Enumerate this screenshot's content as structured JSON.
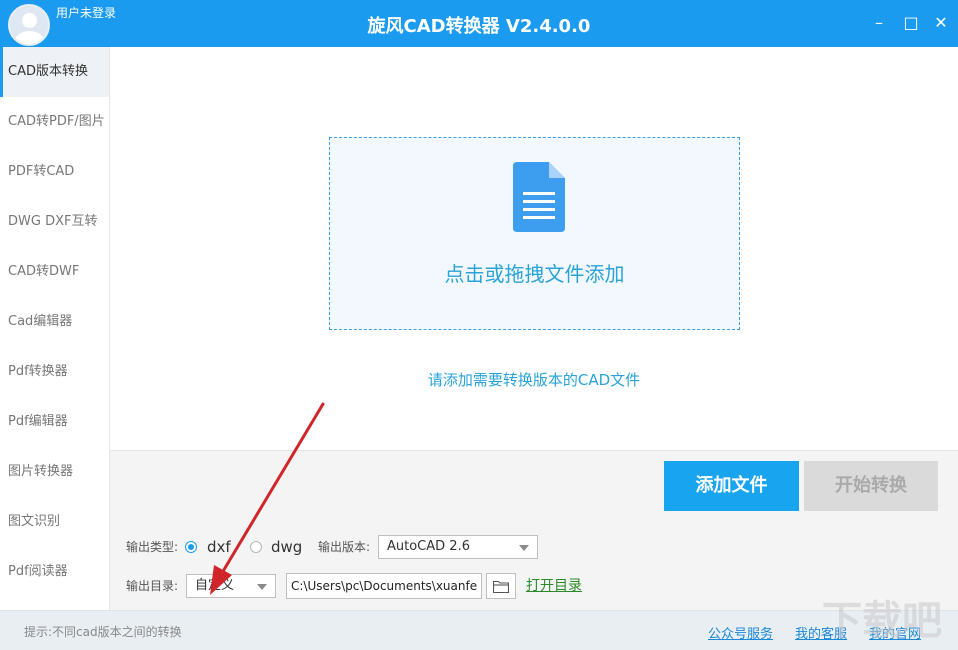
{
  "window": {
    "title": "旋风CAD转换器 V2.4.0.0",
    "user_label": "用户未登录",
    "controls": {
      "minimize": "–",
      "maximize": "□",
      "close": "✕"
    }
  },
  "sidebar": {
    "items": [
      {
        "label": "CAD版本转换",
        "active": true
      },
      {
        "label": "CAD转PDF/图片"
      },
      {
        "label": "PDF转CAD"
      },
      {
        "label": "DWG DXF互转"
      },
      {
        "label": "CAD转DWF"
      },
      {
        "label": "Cad编辑器"
      },
      {
        "label": "Pdf转换器"
      },
      {
        "label": "Pdf编辑器"
      },
      {
        "label": "图片转换器"
      },
      {
        "label": "图文识别"
      },
      {
        "label": "Pdf阅读器"
      }
    ]
  },
  "dropzone": {
    "text": "点击或拖拽文件添加",
    "icon": "document-icon"
  },
  "hint": "请添加需要转换版本的CAD文件",
  "actions": {
    "add_files": "添加文件",
    "start_convert": "开始转换"
  },
  "options": {
    "output_type_label": "输出类型:",
    "output_types": [
      {
        "label": "dxf",
        "selected": true
      },
      {
        "label": "dwg",
        "selected": false
      }
    ],
    "output_version_label": "输出版本:",
    "output_version_value": "AutoCAD 2.6",
    "output_dir_label": "输出目录:",
    "output_dir_mode": "自定义",
    "output_path": "C:\\Users\\pc\\Documents\\xuanfe",
    "open_dir": "打开目录"
  },
  "status": {
    "tip": "提示:不同cad版本之间的转换",
    "links": [
      "公众号服务",
      "我的客服",
      "我的官网"
    ]
  },
  "colors": {
    "accent": "#1a9bf0",
    "link": "#1a88d8",
    "annotation_arrow": "#d0262a"
  }
}
